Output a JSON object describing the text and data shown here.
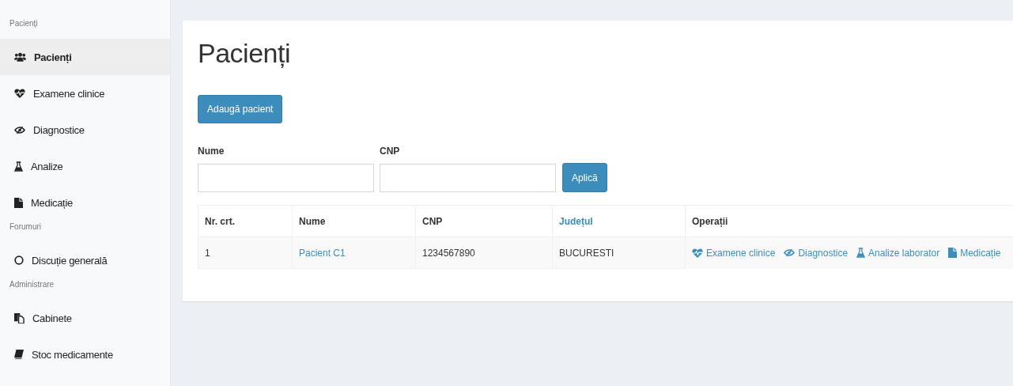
{
  "sidebar": {
    "sections": [
      {
        "title": "Pacienți",
        "items": [
          {
            "label": "Pacienți",
            "kind": "users",
            "selected": true
          },
          {
            "label": "Examene clinice",
            "kind": "heartbeat",
            "selected": false
          },
          {
            "label": "Diagnostice",
            "kind": "eye-slash",
            "selected": false
          },
          {
            "label": "Analize",
            "kind": "flask",
            "selected": false
          },
          {
            "label": "Medicație",
            "kind": "file",
            "selected": false
          }
        ]
      },
      {
        "title": "Forumuri",
        "items": [
          {
            "label": "Discuție generală",
            "kind": "circle",
            "selected": false
          }
        ]
      },
      {
        "title": "Administrare",
        "items": [
          {
            "label": "Cabinete",
            "kind": "clone",
            "selected": false
          },
          {
            "label": "Stoc medicamente",
            "kind": "book",
            "selected": false
          }
        ]
      }
    ]
  },
  "page": {
    "title": "Pacienți",
    "add_button": "Adaugă pacient",
    "filters": [
      {
        "label": "Nume"
      },
      {
        "label": "CNP"
      }
    ],
    "apply_button": "Aplică",
    "table": {
      "columns": [
        {
          "label": "Nr. crt.",
          "sortable": false
        },
        {
          "label": "Nume",
          "sortable": false
        },
        {
          "label": "CNP",
          "sortable": false
        },
        {
          "label": "Județul",
          "sortable": true
        },
        {
          "label": "Operații",
          "sortable": false
        }
      ],
      "rows": [
        {
          "nr": "1",
          "name": "Pacient C1",
          "cnp": "1234567890",
          "county": "BUCURESTI",
          "operations": [
            {
              "label": "Examene clinice",
              "kind": "heartbeat"
            },
            {
              "label": "Diagnostice",
              "kind": "eye-slash"
            },
            {
              "label": "Analize laborator",
              "kind": "flask"
            },
            {
              "label": "Medicație",
              "kind": "file"
            }
          ]
        }
      ]
    }
  }
}
